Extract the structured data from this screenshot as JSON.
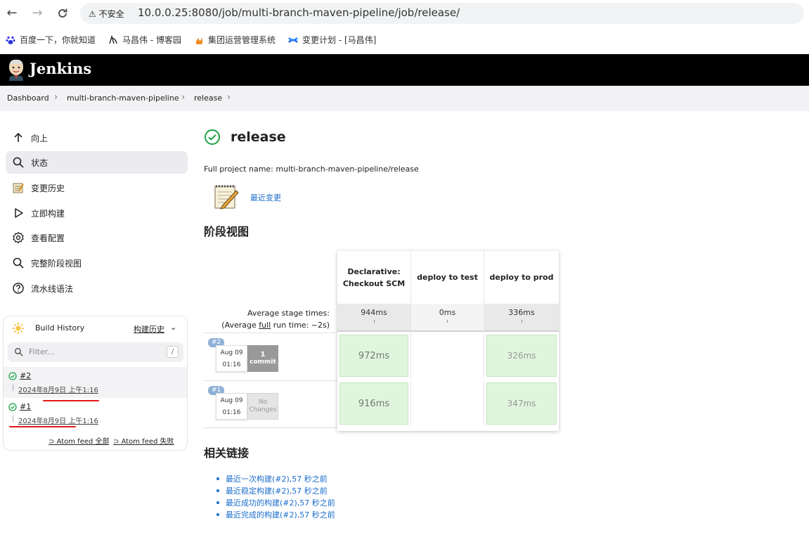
{
  "browser": {
    "insecure_label": "不安全",
    "url": "10.0.0.25:8080/job/multi-branch-maven-pipeline/job/release/"
  },
  "bookmarks": [
    {
      "label": "百度一下，你就知道",
      "icon": "baidu-paw-icon"
    },
    {
      "label": "马昌伟 - 博客园",
      "icon": "cnblogs-icon"
    },
    {
      "label": "集团运营管理系统",
      "icon": "flame-icon"
    },
    {
      "label": "变更计划 - [马昌伟]",
      "icon": "confluence-icon"
    }
  ],
  "header": {
    "title": "Jenkins"
  },
  "breadcrumb": [
    "Dashboard",
    "multi-branch-maven-pipeline",
    "release"
  ],
  "sidebar": {
    "items": [
      {
        "label": "向上",
        "icon": "arrow-up-icon"
      },
      {
        "label": "状态",
        "icon": "search-icon"
      },
      {
        "label": "变更历史",
        "icon": "notepad-icon"
      },
      {
        "label": "立即构建",
        "icon": "play-icon"
      },
      {
        "label": "查看配置",
        "icon": "gear-icon"
      },
      {
        "label": "完整阶段视图",
        "icon": "search-icon"
      },
      {
        "label": "流水线语法",
        "icon": "help-icon"
      }
    ]
  },
  "build_history": {
    "title": "Build History",
    "link": "构建历史",
    "filter_placeholder": "Filter...",
    "filter_shortcut": "/",
    "builds": [
      {
        "number": "#2",
        "date": "2024年8月9日 上午1:16"
      },
      {
        "number": "#1",
        "date": "2024年8月9日 上午1:16"
      }
    ],
    "atom_all": "Atom feed 全部",
    "atom_fail": "Atom feed 失败"
  },
  "main": {
    "title": "release",
    "full_name": "Full project name: multi-branch-maven-pipeline/release",
    "recent_changes": "最近变更",
    "stage_view_title": "阶段视图",
    "related_links_title": "相关链接"
  },
  "stage_view": {
    "avg_label_1": "Average stage times:",
    "avg_label_2a": "(Average ",
    "avg_label_full": "full",
    "avg_label_2b": " run time: ~2s)",
    "stages": [
      {
        "name": "Declarative: Checkout SCM",
        "avg": "944ms"
      },
      {
        "name": "deploy to test",
        "avg": "0ms"
      },
      {
        "name": "deploy to prod",
        "avg": "336ms"
      }
    ],
    "runs": [
      {
        "badge": "#2",
        "date": "Aug 09",
        "time": "01:16",
        "commit_count": "1",
        "commit_label": "commit",
        "durations": [
          "972ms",
          "",
          "326ms"
        ]
      },
      {
        "badge": "#1",
        "date": "Aug 09",
        "time": "01:16",
        "commit_count": "No",
        "commit_label": "Changes",
        "durations": [
          "916ms",
          "",
          "347ms"
        ]
      }
    ]
  },
  "related_links": [
    "最近一次构建(#2),57 秒之前",
    "最近稳定构建(#2),57 秒之前",
    "最近成功的构建(#2),57 秒之前",
    "最近完成的构建(#2),57 秒之前"
  ],
  "colors": {
    "success_green": "#1ea446",
    "stage_success_bg": "#dff6dd",
    "link_blue": "#1a6dcc",
    "header_bg": "#000000",
    "annotation_red": "#e01818"
  }
}
